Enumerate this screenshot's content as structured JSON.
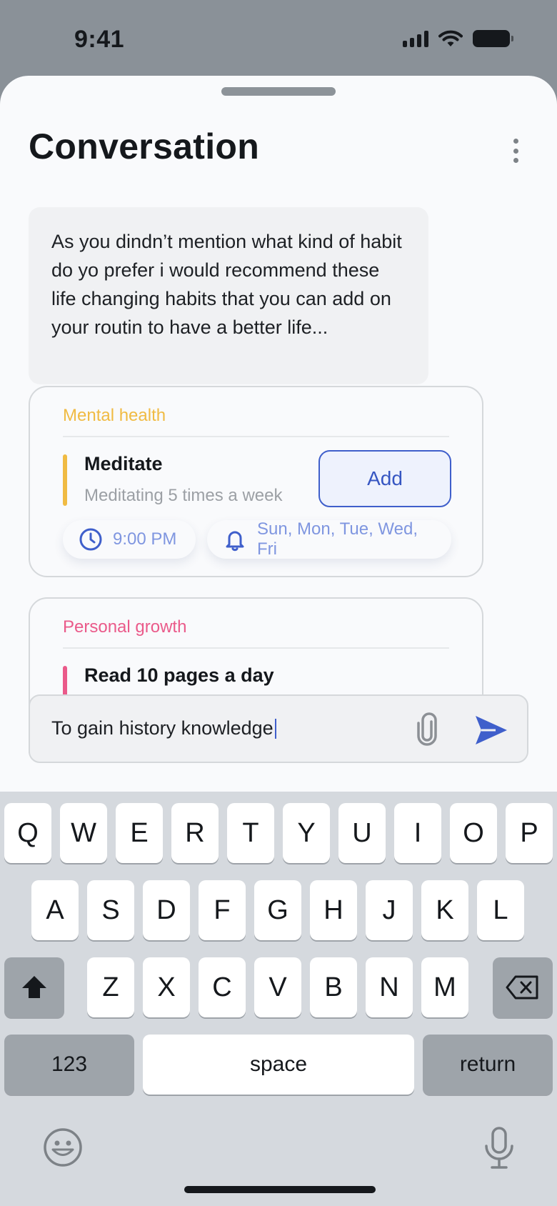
{
  "status_bar": {
    "time": "9:41"
  },
  "header": {
    "title": "Conversation"
  },
  "chat": {
    "message": "As you dindn’t mention what kind of habit do yo prefer i would recommend these life changing habits that you can add on your routin to have a better life...",
    "habits": [
      {
        "category": "Mental health",
        "category_color": "#f0bb43",
        "title": "Meditate",
        "subtitle": "Meditating 5 times a week",
        "add_label": "Add",
        "time": "9:00 PM",
        "days": "Sun, Mon, Tue, Wed, Fri",
        "time_icon": "clock-icon",
        "days_icon": "bell-icon"
      },
      {
        "category": "Personal growth",
        "category_color": "#ea5a8a",
        "title": "Read 10 pages a day"
      }
    ]
  },
  "composer": {
    "value": "To gain history knowledge",
    "attach_icon": "paperclip-icon",
    "send_icon": "send-icon"
  },
  "keyboard": {
    "row1": [
      "Q",
      "W",
      "E",
      "R",
      "T",
      "Y",
      "U",
      "I",
      "O",
      "P"
    ],
    "row2": [
      "A",
      "S",
      "D",
      "F",
      "G",
      "H",
      "J",
      "K",
      "L"
    ],
    "row3": [
      "Z",
      "X",
      "C",
      "V",
      "B",
      "N",
      "M"
    ],
    "numbers_label": "123",
    "space_label": "space",
    "return_label": "return",
    "shift_icon": "shift-icon",
    "delete_icon": "backspace-icon",
    "emoji_icon": "emoji-icon",
    "mic_icon": "microphone-icon"
  },
  "colors": {
    "accent": "#3f5fcb",
    "chip_text": "#7f96e0",
    "sheet_bg": "#f9fafc",
    "keyboard_bg": "#d5d9de"
  }
}
